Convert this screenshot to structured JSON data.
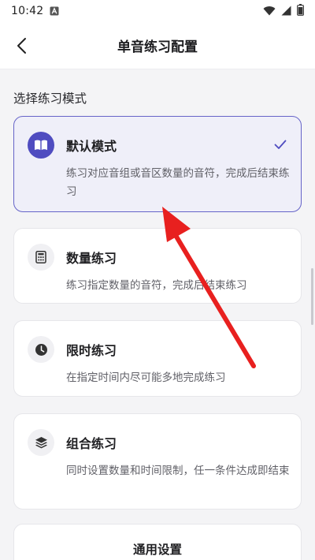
{
  "status_bar": {
    "time": "10:42",
    "app_icon": "a-letter-icon",
    "icons": [
      "wifi-icon",
      "signal-icon",
      "battery-icon"
    ]
  },
  "app_bar": {
    "title": "单音练习配置",
    "back_icon": "chevron-left-icon"
  },
  "section": {
    "title": "选择练习模式"
  },
  "modes": [
    {
      "name": "默认模式",
      "description": "练习对应音组或音区数量的音符，完成后结束练习",
      "icon": "book-icon",
      "selected": true
    },
    {
      "name": "数量练习",
      "description": "练习指定数量的音符，完成后结束练习",
      "icon": "calculator-icon",
      "selected": false
    },
    {
      "name": "限时练习",
      "description": "在指定时间内尽可能多地完成练习",
      "icon": "clock-icon",
      "selected": false
    },
    {
      "name": "组合练习",
      "description": "同时设置数量和时间限制，任一条件达成即结束",
      "icon": "layers-icon",
      "selected": false
    }
  ],
  "general_settings": {
    "title": "通用设置"
  },
  "colors": {
    "accent": "#4f4cc0",
    "selected_border": "#6664c8",
    "selected_bg": "#efeff9",
    "annotation_arrow": "#e8201f"
  }
}
